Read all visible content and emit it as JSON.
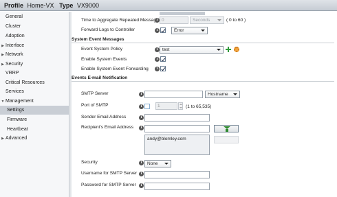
{
  "header": {
    "profile_label": "Profile",
    "profile_name": "Home-VX",
    "type_label": "Type",
    "type_value": "VX9000"
  },
  "sidebar": {
    "items": [
      {
        "label": "General",
        "arrow": ""
      },
      {
        "label": "Cluster",
        "arrow": ""
      },
      {
        "label": "Adoption",
        "arrow": ""
      },
      {
        "label": "Interface",
        "arrow": "▶"
      },
      {
        "label": "Network",
        "arrow": "▶"
      },
      {
        "label": "Security",
        "arrow": "▶"
      },
      {
        "label": "VRRP",
        "arrow": ""
      },
      {
        "label": "Critical Resources",
        "arrow": ""
      },
      {
        "label": "Services",
        "arrow": ""
      },
      {
        "label": "Management",
        "arrow": "▼"
      },
      {
        "label": "Settings",
        "arrow": ""
      },
      {
        "label": "Firmware",
        "arrow": ""
      },
      {
        "label": "Heartbeat",
        "arrow": ""
      },
      {
        "label": "Advanced",
        "arrow": "▶"
      }
    ]
  },
  "form": {
    "aggregate": {
      "label": "Time to Aggregate Repeated Messages",
      "value": "0",
      "unit": "Seconds",
      "range": "( 0 to 60 )"
    },
    "forward_logs": {
      "label": "Forward Logs to Controller",
      "level": "Error",
      "checked": true
    },
    "system_events": {
      "title": "System Event Messages",
      "policy_label": "Event System Policy",
      "policy_value": "test",
      "enable_label": "Enable System Events",
      "forwarding_label": "Enable System Event Forwarding"
    },
    "email": {
      "title": "Events E-mail Notification",
      "smtp_server_label": "SMTP Server",
      "smtp_server_value": "",
      "smtp_server_type": "Hostname",
      "port_label": "Port of SMTP",
      "port_value": "1",
      "port_range": "(1 to 65,535)",
      "sender_label": "Sender Email Address",
      "sender_value": "",
      "recipient_label": "Recipient's Email Address",
      "recipient_input": "",
      "recipients": [
        "andy@blomley.com"
      ],
      "security_label": "Security",
      "security_value": "None",
      "username_label": "Username for SMTP Server",
      "username_value": "",
      "password_label": "Password for SMTP Server",
      "password_value": ""
    }
  },
  "icons": {
    "info": "i",
    "add_recipient": "green-down-arrow-icon",
    "create_policy": "plus-icon",
    "edit_policy": "gear-icon"
  }
}
